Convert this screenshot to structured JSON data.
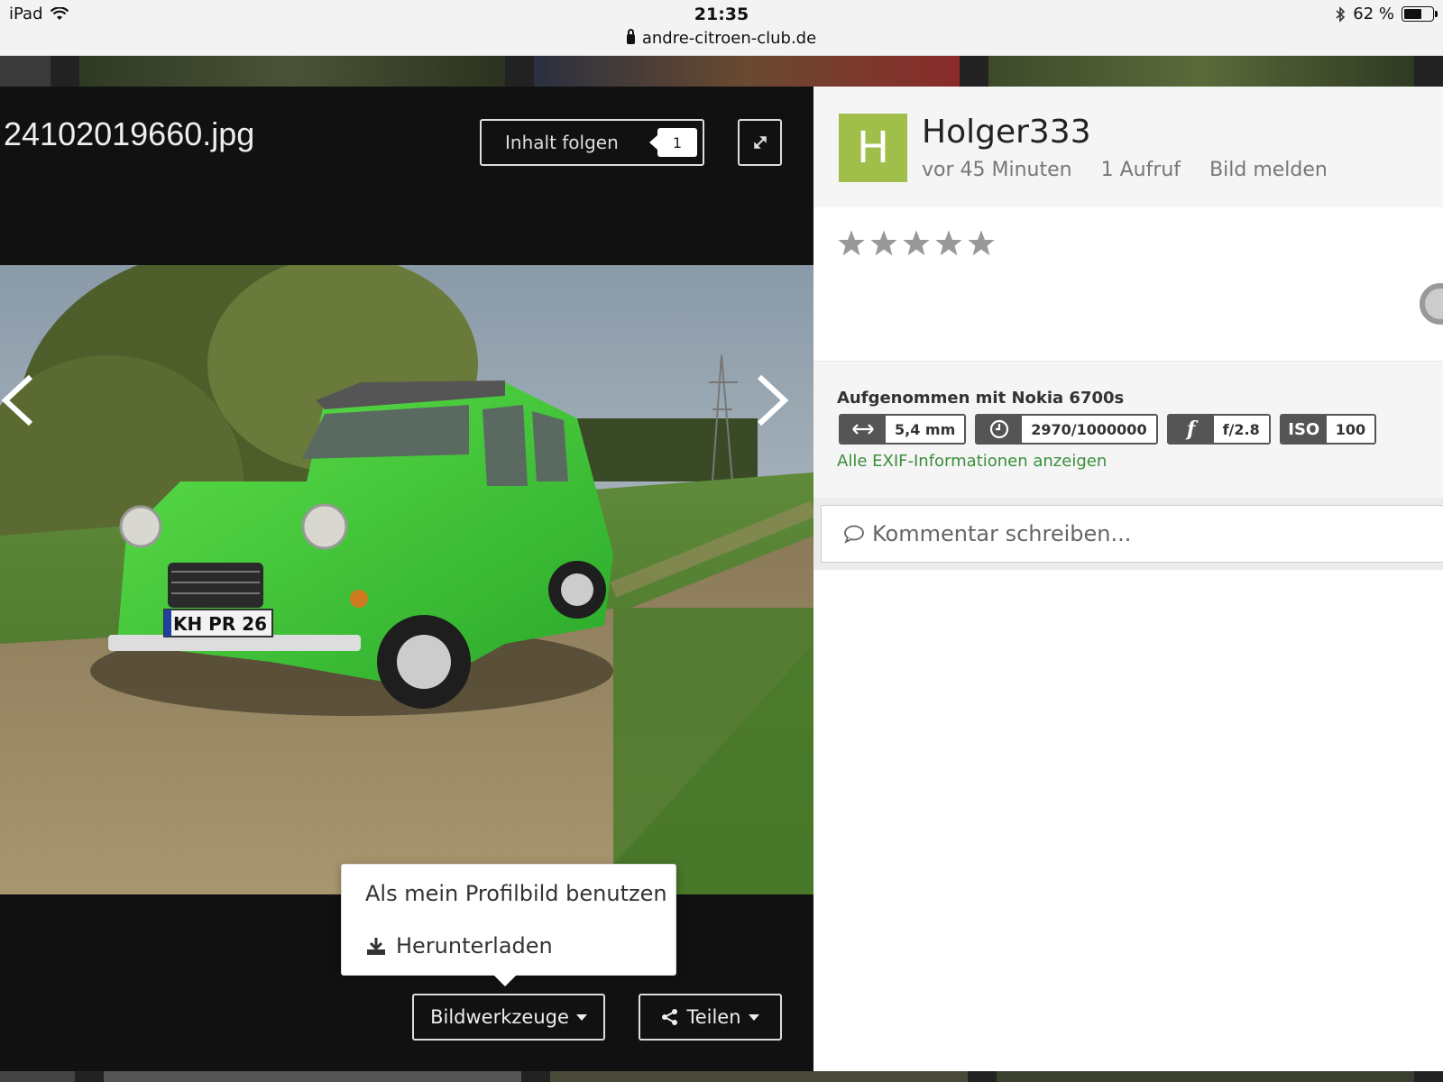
{
  "status_bar": {
    "device": "iPad",
    "time": "21:35",
    "url": "andre-citroen-club.de",
    "battery": "62 %",
    "battery_level": 0.62
  },
  "viewer": {
    "filename": "24102019660.jpg",
    "follow_label": "Inhalt folgen",
    "follow_count": "1",
    "plate": "KH PR 26",
    "menu": {
      "profile_label": "Als mein Profilbild benutzen",
      "download_label": "Herunterladen"
    },
    "tools_label": "Bildwerkzeuge",
    "share_label": "Teilen"
  },
  "panel": {
    "avatar_letter": "H",
    "avatar_color": "#9fbf4a",
    "username": "Holger333",
    "time_ago": "vor 45 Minuten",
    "views": "1 Aufruf",
    "report": "Bild melden",
    "rating": 0,
    "exif": {
      "title": "Aufgenommen mit Nokia 6700s",
      "focal": "5,4 mm",
      "exposure": "2970/1000000",
      "aperture_icon": "f",
      "aperture": "f/2.8",
      "iso_label": "ISO",
      "iso": "100",
      "link": "Alle EXIF-Informationen anzeigen"
    },
    "comment_placeholder": "Kommentar schreiben..."
  }
}
